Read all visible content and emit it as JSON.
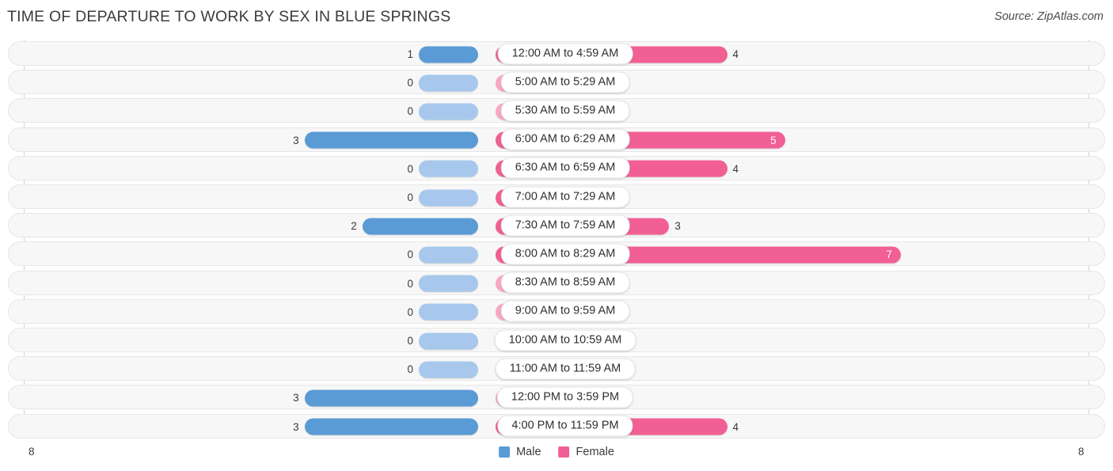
{
  "header": {
    "title": "TIME OF DEPARTURE TO WORK BY SEX IN BLUE SPRINGS",
    "source": "Source: ZipAtlas.com"
  },
  "legend": {
    "male_label": "Male",
    "female_label": "Female",
    "male_color": "#5B9BD5",
    "female_color": "#F25F94"
  },
  "axis": {
    "left_tick": "8",
    "right_tick": "8"
  },
  "colors": {
    "male_strong": "#5B9BD5",
    "male_zero": "#A7C8EC",
    "female_strong": "#F25F94",
    "female_zero": "#F9A8C4",
    "track": "#f7f7f7",
    "track_border": "#e6e6e6"
  },
  "chart_data": {
    "type": "bar",
    "title": "TIME OF DEPARTURE TO WORK BY SEX IN BLUE SPRINGS",
    "subtitle": "",
    "xlabel": "",
    "ylabel": "",
    "orientation": "horizontal-diverging",
    "xlim": [
      0,
      8
    ],
    "grid": false,
    "legend_position": "bottom-center",
    "categories": [
      "12:00 AM to 4:59 AM",
      "5:00 AM to 5:29 AM",
      "5:30 AM to 5:59 AM",
      "6:00 AM to 6:29 AM",
      "6:30 AM to 6:59 AM",
      "7:00 AM to 7:29 AM",
      "7:30 AM to 7:59 AM",
      "8:00 AM to 8:29 AM",
      "8:30 AM to 8:59 AM",
      "9:00 AM to 9:59 AM",
      "10:00 AM to 10:59 AM",
      "11:00 AM to 11:59 AM",
      "12:00 PM to 3:59 PM",
      "4:00 PM to 11:59 PM"
    ],
    "series": [
      {
        "name": "Male",
        "values": [
          1,
          0,
          0,
          3,
          0,
          0,
          2,
          0,
          0,
          0,
          0,
          0,
          3,
          3
        ]
      },
      {
        "name": "Female",
        "values": [
          4,
          0,
          0,
          5,
          4,
          2,
          3,
          7,
          0,
          0,
          0,
          0,
          0,
          4
        ]
      }
    ]
  },
  "rows": [
    {
      "label": "12:00 AM to 4:59 AM",
      "male": "1",
      "female": "4"
    },
    {
      "label": "5:00 AM to 5:29 AM",
      "male": "0",
      "female": "0"
    },
    {
      "label": "5:30 AM to 5:59 AM",
      "male": "0",
      "female": "0"
    },
    {
      "label": "6:00 AM to 6:29 AM",
      "male": "3",
      "female": "5"
    },
    {
      "label": "6:30 AM to 6:59 AM",
      "male": "0",
      "female": "4"
    },
    {
      "label": "7:00 AM to 7:29 AM",
      "male": "0",
      "female": "2"
    },
    {
      "label": "7:30 AM to 7:59 AM",
      "male": "2",
      "female": "3"
    },
    {
      "label": "8:00 AM to 8:29 AM",
      "male": "0",
      "female": "7"
    },
    {
      "label": "8:30 AM to 8:59 AM",
      "male": "0",
      "female": "0"
    },
    {
      "label": "9:00 AM to 9:59 AM",
      "male": "0",
      "female": "0"
    },
    {
      "label": "10:00 AM to 10:59 AM",
      "male": "0",
      "female": "0"
    },
    {
      "label": "11:00 AM to 11:59 AM",
      "male": "0",
      "female": "0"
    },
    {
      "label": "12:00 PM to 3:59 PM",
      "male": "3",
      "female": "0"
    },
    {
      "label": "4:00 PM to 11:59 PM",
      "male": "3",
      "female": "4"
    }
  ]
}
